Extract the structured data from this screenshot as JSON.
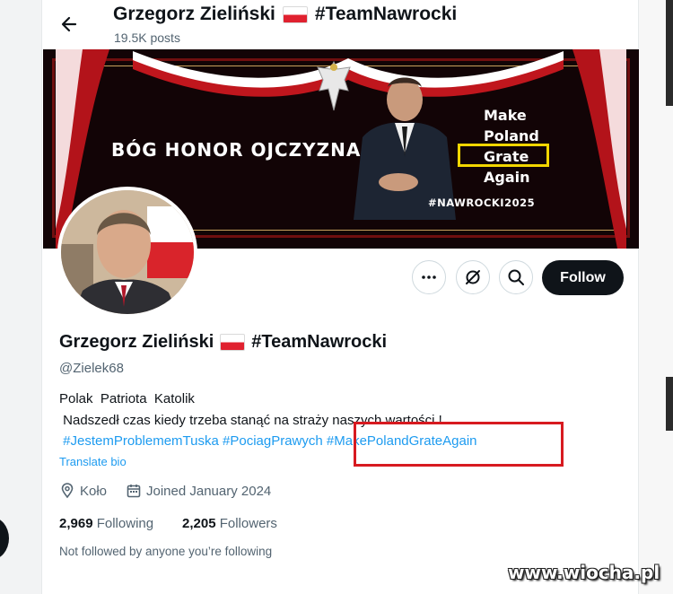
{
  "header": {
    "name": "Grzegorz Zieliński",
    "hashtag": "#TeamNawrocki",
    "posts": "19.5K posts"
  },
  "banner": {
    "motto": "BÓG HONOR OJCZYZNA",
    "slogan": [
      "Make",
      "Poland",
      "Grate",
      "Again"
    ],
    "hashtag": "#NAWROCKI2025"
  },
  "actions": {
    "follow_label": "Follow"
  },
  "profile": {
    "name": "Grzegorz Zieliński",
    "hashtag": "#TeamNawrocki",
    "handle": "@Zielek68",
    "bio_line1": "Polak  Patriota  Katolik",
    "bio_line2": " Nadszedł czas kiedy trzeba stanąć na straży naszych wartości !",
    "bio_line3": " #JestemProblememTuska #PociagPrawych #MakePolandGrateAgain",
    "translate": "Translate bio",
    "location": "Koło",
    "joined": "Joined January 2024",
    "following_count": "2,969",
    "following_label": "Following",
    "followers_count": "2,205",
    "followers_label": "Followers",
    "not_followed": "Not followed by anyone you’re following"
  },
  "watermark": "www.wiocha.pl",
  "colors": {
    "accent": "#1d9bf0",
    "text": "#0f1419",
    "muted": "#536471",
    "highlight_red": "#d71a20",
    "highlight_yellow": "#f2d600",
    "flag_red": "#e0212f"
  },
  "icons": [
    "back-arrow-icon",
    "poland-flag-icon",
    "more-icon",
    "grok-icon",
    "search-icon",
    "location-icon",
    "calendar-icon"
  ]
}
